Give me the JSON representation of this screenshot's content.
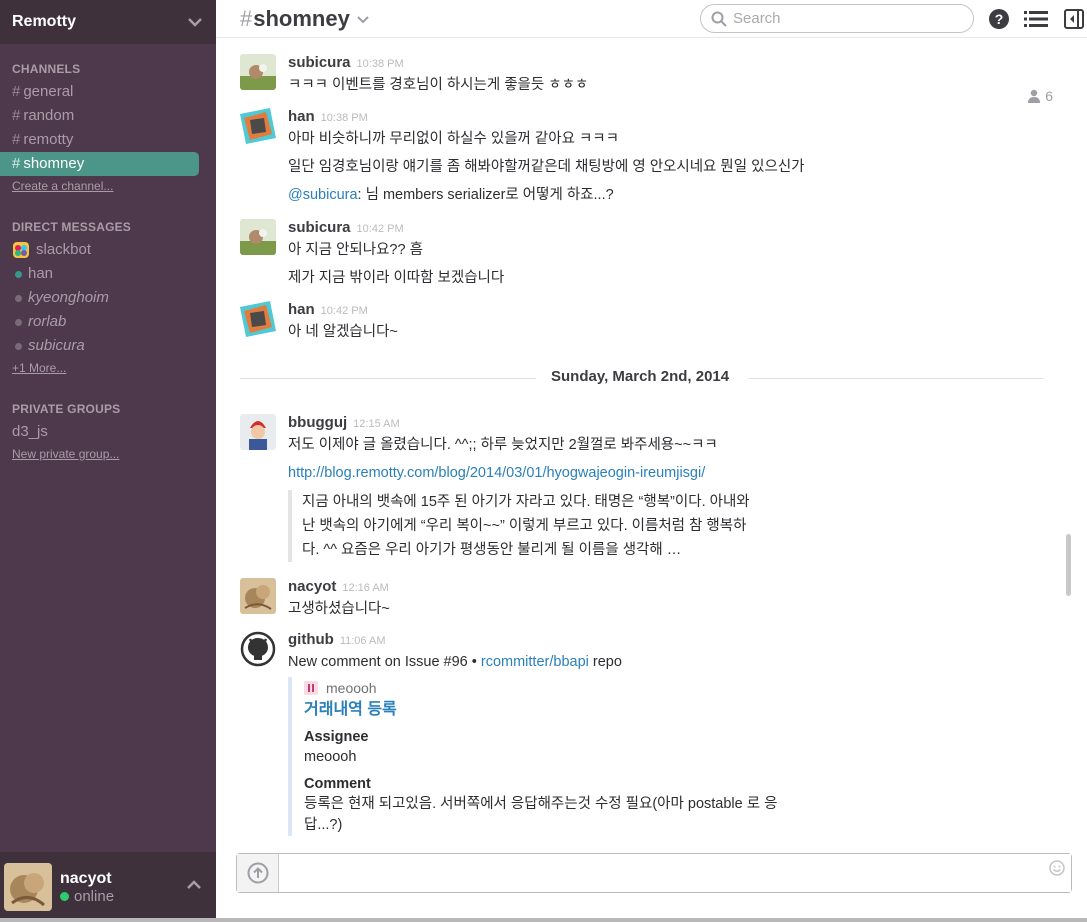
{
  "team": {
    "name": "Remotty"
  },
  "channels": {
    "title": "CHANNELS",
    "items": [
      {
        "name": "general",
        "active": false
      },
      {
        "name": "random",
        "active": false
      },
      {
        "name": "remotty",
        "active": false
      },
      {
        "name": "shomney",
        "active": true
      }
    ],
    "create_label": "Create a channel..."
  },
  "dms": {
    "title": "DIRECT MESSAGES",
    "items": [
      {
        "name": "slackbot",
        "status": "bot"
      },
      {
        "name": "han",
        "status": "online"
      },
      {
        "name": "kyeonghoim",
        "status": "away"
      },
      {
        "name": "rorlab",
        "status": "away"
      },
      {
        "name": "subicura",
        "status": "away"
      }
    ],
    "more_label": "+1 More..."
  },
  "groups": {
    "title": "PRIVATE GROUPS",
    "items": [
      {
        "name": "d3_js"
      }
    ],
    "new_label": "New private group..."
  },
  "user": {
    "name": "nacyot",
    "status": "online"
  },
  "header": {
    "hash": "#",
    "channel": "shomney",
    "search_placeholder": "Search",
    "member_count": "6"
  },
  "messages": [
    {
      "author": "subicura",
      "time": "10:38 PM",
      "lines": [
        "ㅋㅋㅋ 이벤트를 경호님이 하시는게 좋을듯 ㅎㅎㅎ"
      ]
    },
    {
      "author": "han",
      "time": "10:38 PM",
      "lines": [
        "아마 비슷하니까 무리없이 하실수 있을꺼 같아요 ㅋㅋㅋ",
        "일단 임경호님이랑 얘기를 좀 해봐야할꺼같은데 채팅방에 영 안오시네요 뭔일 있으신가"
      ],
      "mention": "@subicura",
      "mention_rest": ": 님 members serializer로 어떻게 하죠...?"
    },
    {
      "author": "subicura",
      "time": "10:42 PM",
      "lines": [
        "아 지금 안되나요?? 흠",
        "제가 지금 밖이라 이따함 보겠습니다"
      ]
    },
    {
      "author": "han",
      "time": "10:42 PM",
      "lines": [
        "아 네 알겠습니다~"
      ]
    },
    {
      "author": "bbugguj",
      "time": "12:15 AM",
      "lines": [
        "저도 이제야 글 올렸습니다. ^^;;  하루 늦었지만 2월껄로 봐주세용~~ㅋㅋ"
      ],
      "link": "http://blog.remotty.com/blog/2014/03/01/hyogwajeogin-ireumjisgi/",
      "quote": [
        "지금 아내의 뱃속에 15주 된 아기가 자라고 있다. 태명은 “행복”이다. 아내와",
        "난 뱃속의 아기에게 “우리 복이~~” 이렇게 부르고 있다. 이름처럼 참 행복하",
        "다. ^^ 요즘은 우리 아기가 평생동안 불리게 될 이름을 생각해 …"
      ]
    },
    {
      "author": "nacyot",
      "time": "12:16 AM",
      "lines": [
        "고생하셨습니다~"
      ]
    },
    {
      "author": "github",
      "time": "11:06 AM",
      "text_prefix": "New comment on Issue #96 • ",
      "repo_link": "rcommitter/bbapi",
      "text_suffix": " repo",
      "attachment": {
        "author": "meoooh",
        "title": "거래내역 등록",
        "fields": [
          {
            "title": "Assignee",
            "value": "meoooh",
            "is_link": true
          },
          {
            "title": "Comment",
            "value": "등록은 현재 되고있음. 서버쪽에서 응답해주는것 수정 필요(아마 postable 로 응답...?)"
          }
        ]
      }
    }
  ],
  "day_divider": "Sunday, March 2nd, 2014",
  "colors": {
    "sidebar": "#4d394b",
    "active": "#4c9689",
    "link": "#2a80b9"
  }
}
